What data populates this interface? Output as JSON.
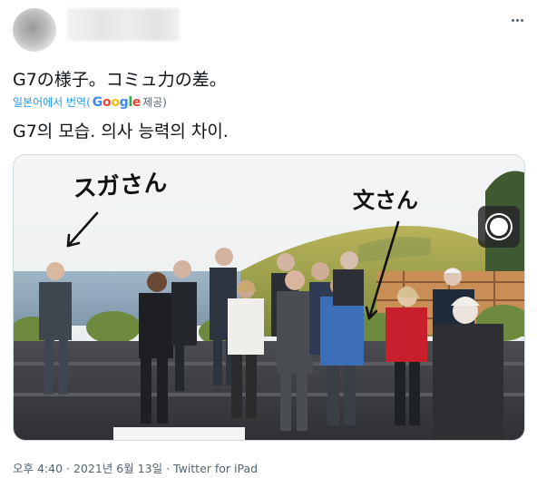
{
  "tweet": {
    "text_ja": "G7の様子。コミュ力の差。",
    "translation": {
      "prefix": "일본어에서 번역(",
      "google_letters": [
        "G",
        "o",
        "o",
        "g",
        "l",
        "e"
      ],
      "suffix": " 제공)"
    },
    "text_ko": "G7의 모습. 의사 능력의 차이.",
    "annotations": {
      "left": "スガさん",
      "right": "文さん"
    },
    "meta": {
      "time": "오후 4:40",
      "sep1": " · ",
      "date": "2021년 6월 13일",
      "sep2": " · ",
      "source": "Twitter for iPad"
    }
  },
  "colors": {
    "link": "#1d9bf0",
    "muted": "#536471",
    "text": "#0f1419"
  }
}
